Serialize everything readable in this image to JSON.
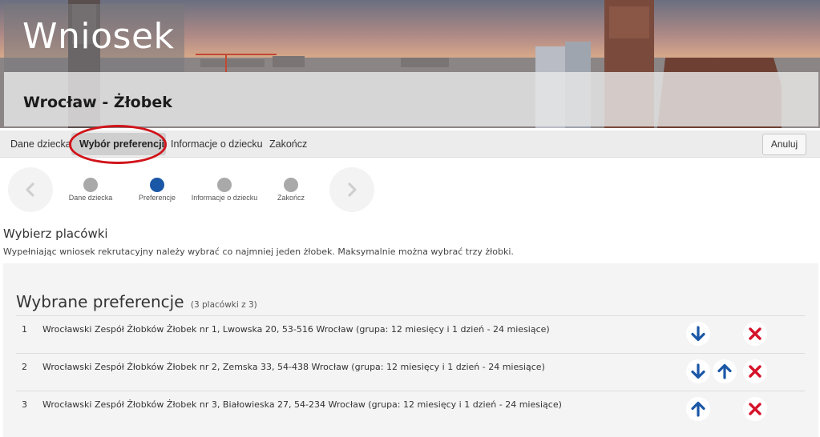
{
  "header": {
    "title": "Wniosek",
    "subtitle": "Wrocław - Żłobek"
  },
  "nav": {
    "items": [
      {
        "label": "Dane dziecka"
      },
      {
        "label": "Wybór preferencji"
      },
      {
        "label": "Informacje o dziecku"
      },
      {
        "label": "Zakończ"
      }
    ],
    "cancel_label": "Anuluj"
  },
  "stepper": {
    "current_step": 2,
    "steps": [
      {
        "label": "Dane dziecka"
      },
      {
        "label": "Preferencje"
      },
      {
        "label": "Informacje o dziecku"
      },
      {
        "label": "Zakończ"
      }
    ],
    "icons": {
      "prev": "chevron-left-icon",
      "next": "chevron-right-icon"
    }
  },
  "content": {
    "title": "Wybierz placówki",
    "description": "Wypełniając wniosek rekrutacyjny należy wybrać co najmniej jeden żłobek. Maksymalnie można wybrać trzy żłobki."
  },
  "preferences": {
    "title": "Wybrane preferencje",
    "count_text": "(3 placówki z 3)",
    "rows": [
      {
        "num": "1",
        "text": "Wrocławski Zespół Żłobków Żłobek nr 1, Lwowska 20, 53-516 Wrocław (grupa: 12 miesięcy i 1 dzień - 24 miesiące)",
        "can_move_up": false,
        "can_move_down": true
      },
      {
        "num": "2",
        "text": "Wrocławski Zespół Żłobków Żłobek nr 2, Zemska 33, 54-438 Wrocław (grupa: 12 miesięcy i 1 dzień - 24 miesiące)",
        "can_move_up": true,
        "can_move_down": true
      },
      {
        "num": "3",
        "text": "Wrocławski Zespół Żłobków Żłobek nr 3, Białowieska 27, 54-234 Wrocław (grupa: 12 miesięcy i 1 dzień - 24 miesiące)",
        "can_move_up": true,
        "can_move_down": false
      }
    ],
    "icons": {
      "down": "arrow-down-icon",
      "up": "arrow-up-icon",
      "remove": "close-icon"
    }
  },
  "colors": {
    "accent": "#1a57a6",
    "remove": "#d5132a",
    "highlight": "#d0141a",
    "step_inactive": "#a9a9a9"
  }
}
